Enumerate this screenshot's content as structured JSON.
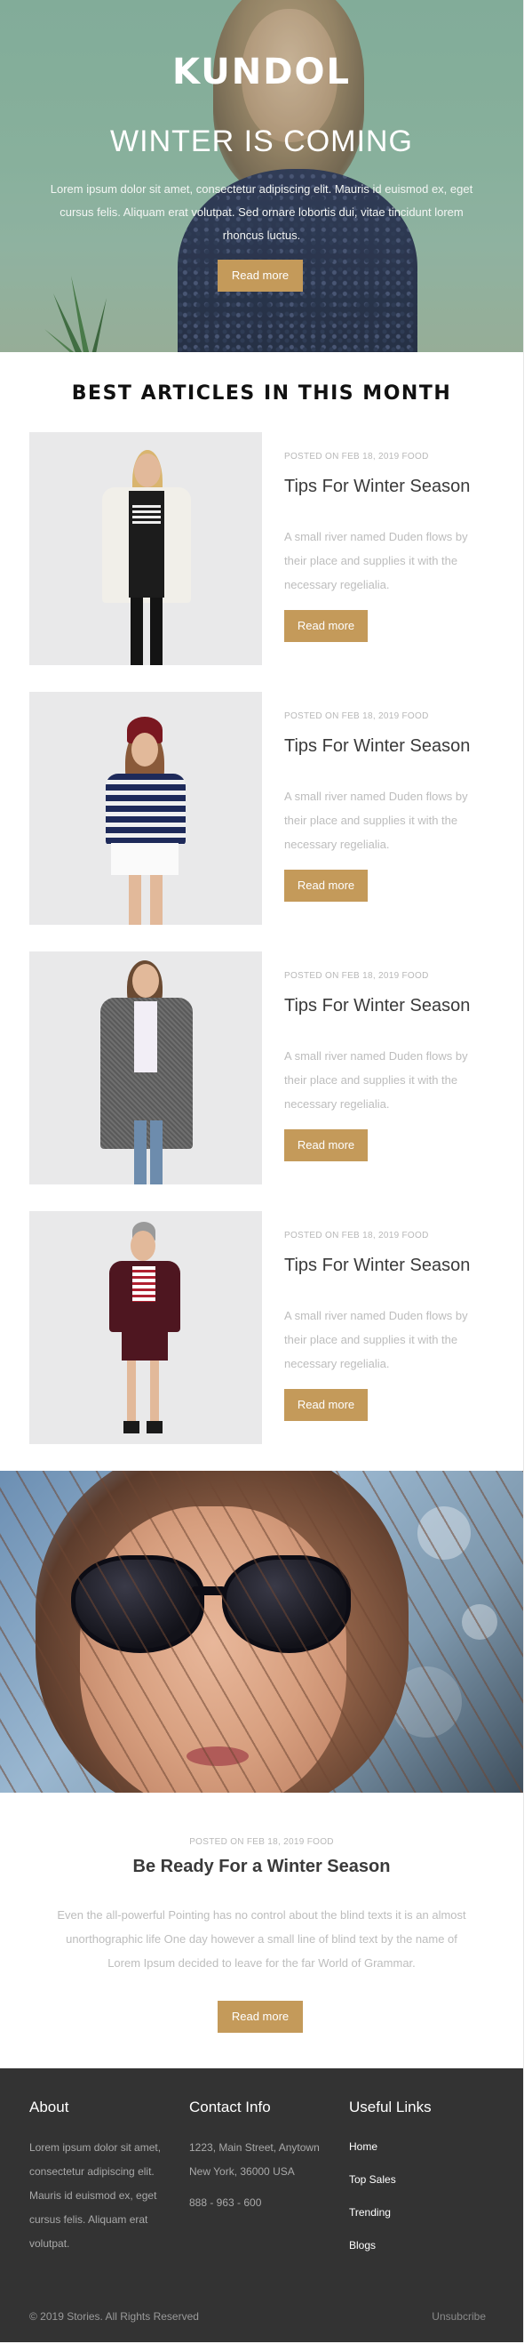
{
  "colors": {
    "accent": "#c49a5a",
    "footer_bg": "#333333",
    "muted_text": "#bdbdbd"
  },
  "hero": {
    "logo": "KUNDOL",
    "title": "WINTER IS COMING",
    "text": "Lorem ipsum dolor sit amet, consectetur adipiscing elit. Mauris id euismod ex, eget cursus felis. Aliquam erat volutpat. Sed ornare lobortis dui, vitae tincidunt lorem rhoncus luctus.",
    "button": "Read more"
  },
  "articles": {
    "heading": "BEST ARTICLES IN THIS MONTH",
    "items": [
      {
        "meta": "POSTED ON FEB 18, 2019 FOOD",
        "title": "Tips For Winter Season",
        "desc": "A small river named Duden flows by their place and supplies it with the necessary regelialia.",
        "button": "Read more"
      },
      {
        "meta": "POSTED ON FEB 18, 2019 FOOD",
        "title": "Tips For Winter Season",
        "desc": "A small river named Duden flows by their place and supplies it with the necessary regelialia.",
        "button": "Read more"
      },
      {
        "meta": "POSTED ON FEB 18, 2019 FOOD",
        "title": "Tips For Winter Season",
        "desc": "A small river named Duden flows by their place and supplies it with the necessary regelialia.",
        "button": "Read more"
      },
      {
        "meta": "POSTED ON FEB 18, 2019 FOOD",
        "title": "Tips For Winter Season",
        "desc": "A small river named Duden flows by their place and supplies it with the necessary regelialia.",
        "button": "Read more"
      }
    ]
  },
  "feature": {
    "meta": "POSTED ON FEB 18, 2019 FOOD",
    "title": "Be Ready For a Winter Season",
    "desc": "Even the all-powerful Pointing has no control about the blind texts it is an almost unorthographic life One day however a small line of blind text by the name of Lorem Ipsum decided to leave for the far World of Grammar.",
    "button": "Read more"
  },
  "footer": {
    "about": {
      "heading": "About",
      "text": "Lorem ipsum dolor sit amet, consectetur adipiscing elit. Mauris id euismod ex, eget cursus felis. Aliquam erat volutpat."
    },
    "contact": {
      "heading": "Contact Info",
      "address": "1223, Main Street, Anytown New York, 36000 USA",
      "phone": "888 - 963 - 600"
    },
    "links": {
      "heading": "Useful Links",
      "items": [
        "Home",
        "Top Sales",
        "Trending",
        "Blogs"
      ]
    },
    "copyright": "© 2019 Stories. All Rights Reserved",
    "unsubscribe": "Unsubcribe"
  }
}
